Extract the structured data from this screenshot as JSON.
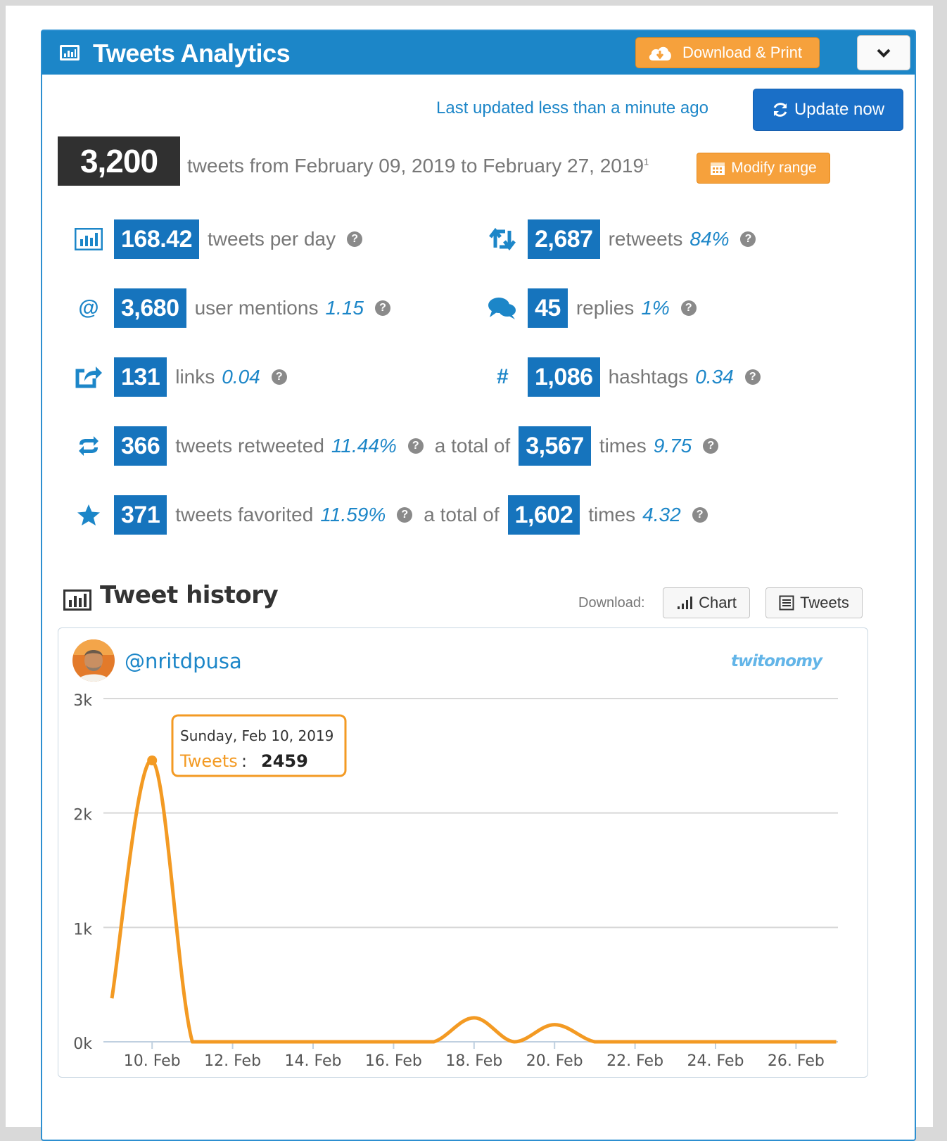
{
  "header": {
    "title": "Tweets Analytics",
    "download_label": "Download & Print"
  },
  "status": {
    "last_updated": "Last updated less than a minute ago",
    "update_label": "Update now"
  },
  "summary": {
    "total": "3,200",
    "range_text": "tweets from February 09, 2019 to February 27, 2019",
    "footnote": "1",
    "modify_label": "Modify range"
  },
  "stats": {
    "per_day": {
      "value": "168.42",
      "label": "tweets per day"
    },
    "retweets": {
      "value": "2,687",
      "label": "retweets",
      "pct": "84%"
    },
    "mentions": {
      "value": "3,680",
      "label": "user mentions",
      "pct": "1.15"
    },
    "replies": {
      "value": "45",
      "label": "replies",
      "pct": "1%"
    },
    "links": {
      "value": "131",
      "label": "links",
      "pct": "0.04"
    },
    "hashtags": {
      "value": "1,086",
      "label": "hashtags",
      "pct": "0.34"
    },
    "retweeted": {
      "value": "366",
      "label": "tweets retweeted",
      "pct": "11.44%",
      "total_label": "a total of",
      "total": "3,567",
      "times_label": "times",
      "times": "9.75"
    },
    "favorited": {
      "value": "371",
      "label": "tweets favorited",
      "pct": "11.59%",
      "total_label": "a total of",
      "total": "1,602",
      "times_label": "times",
      "times": "4.32"
    }
  },
  "history": {
    "title": "Tweet history",
    "download_label": "Download:",
    "chart_btn": "Chart",
    "tweets_btn": "Tweets",
    "handle": "@nritdpusa",
    "brand": "twitonomy"
  },
  "tooltip": {
    "date": "Sunday, Feb 10, 2019",
    "series": "Tweets",
    "value": "2459"
  },
  "colors": {
    "accent": "#1c86c8",
    "orange": "#f6a13c",
    "line": "#f39a23"
  },
  "chart_data": {
    "type": "line",
    "series": [
      {
        "name": "Tweets",
        "x": [
          "Feb 9",
          "Feb 10",
          "Feb 11",
          "Feb 12",
          "Feb 13",
          "Feb 14",
          "Feb 15",
          "Feb 16",
          "Feb 17",
          "Feb 18",
          "Feb 19",
          "Feb 20",
          "Feb 21",
          "Feb 22",
          "Feb 23",
          "Feb 24",
          "Feb 25",
          "Feb 26",
          "Feb 27"
        ],
        "values": [
          380,
          2459,
          0,
          0,
          0,
          0,
          0,
          0,
          0,
          210,
          0,
          150,
          0,
          0,
          0,
          0,
          0,
          0,
          0
        ]
      }
    ],
    "x_tick_labels": [
      "10. Feb",
      "12. Feb",
      "14. Feb",
      "16. Feb",
      "18. Feb",
      "20. Feb",
      "22. Feb",
      "24. Feb",
      "26. Feb"
    ],
    "y_tick_labels": [
      "0k",
      "1k",
      "2k",
      "3k"
    ],
    "ylim": [
      0,
      3000
    ],
    "grid": true
  }
}
